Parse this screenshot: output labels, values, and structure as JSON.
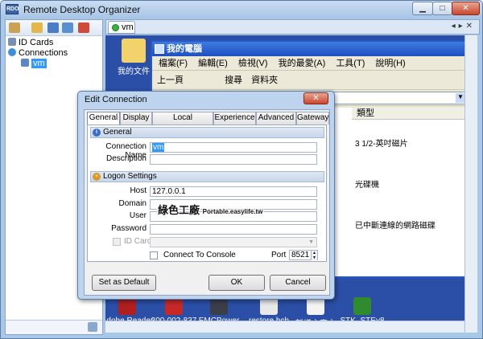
{
  "app": {
    "title": "Remote Desktop Organizer",
    "icon_label": "RDO"
  },
  "window_controls": {
    "minimize": "▁",
    "maximize": "□",
    "close": "✕"
  },
  "tree": {
    "items": [
      {
        "label": "ID Cards",
        "icon": "id-card-icon"
      },
      {
        "label": "Connections",
        "icon": "globe-icon"
      },
      {
        "label": "vm",
        "icon": "computer-icon"
      }
    ]
  },
  "session": {
    "tab_label": "vm",
    "tab_controls": "◂▸✕"
  },
  "remote_desktop": {
    "icon_my_documents": "我的文件",
    "explorer": {
      "title": "我的電腦",
      "menu": [
        "檔案(F)",
        "編輯(E)",
        "檢視(V)",
        "我的最愛(A)",
        "工具(T)",
        "說明(H)"
      ],
      "toolbar": {
        "back": "上一頁",
        "search": "搜尋",
        "folders": "資料夾"
      },
      "column_type": "類型",
      "types": [
        "3 1/2-英吋磁片",
        "光碟機",
        "已中斷連線的網路磁碟"
      ]
    },
    "icon_script": "script",
    "taskbar_icons": [
      "Adobe Reader",
      "300-002-837",
      "EMCPower",
      "restore.bch",
      "新增文字文",
      "STK_STEy8"
    ]
  },
  "dialog": {
    "title": "Edit Connection",
    "close": "✕",
    "tabs": [
      "General",
      "Display",
      "Local Resources",
      "Experience",
      "Advanced",
      "Gateway"
    ],
    "general_group": "General",
    "connection_name_label": "Connection Name",
    "connection_name_value": "vm",
    "description_label": "Description",
    "description_value": "",
    "logon_group": "Logon Settings",
    "host_label": "Host",
    "host_value": "127.0.0.1",
    "domain_label": "Domain",
    "user_label": "User",
    "password_label": "Password",
    "id_card_label": "ID Card",
    "connect_console_label": "Connect To Console",
    "port_label": "Port",
    "port_value": "8521",
    "set_default": "Set as Default",
    "ok": "OK",
    "cancel": "Cancel"
  },
  "watermark": {
    "cn": "綠色工廠",
    "url": "Portable.easylife.tw"
  }
}
